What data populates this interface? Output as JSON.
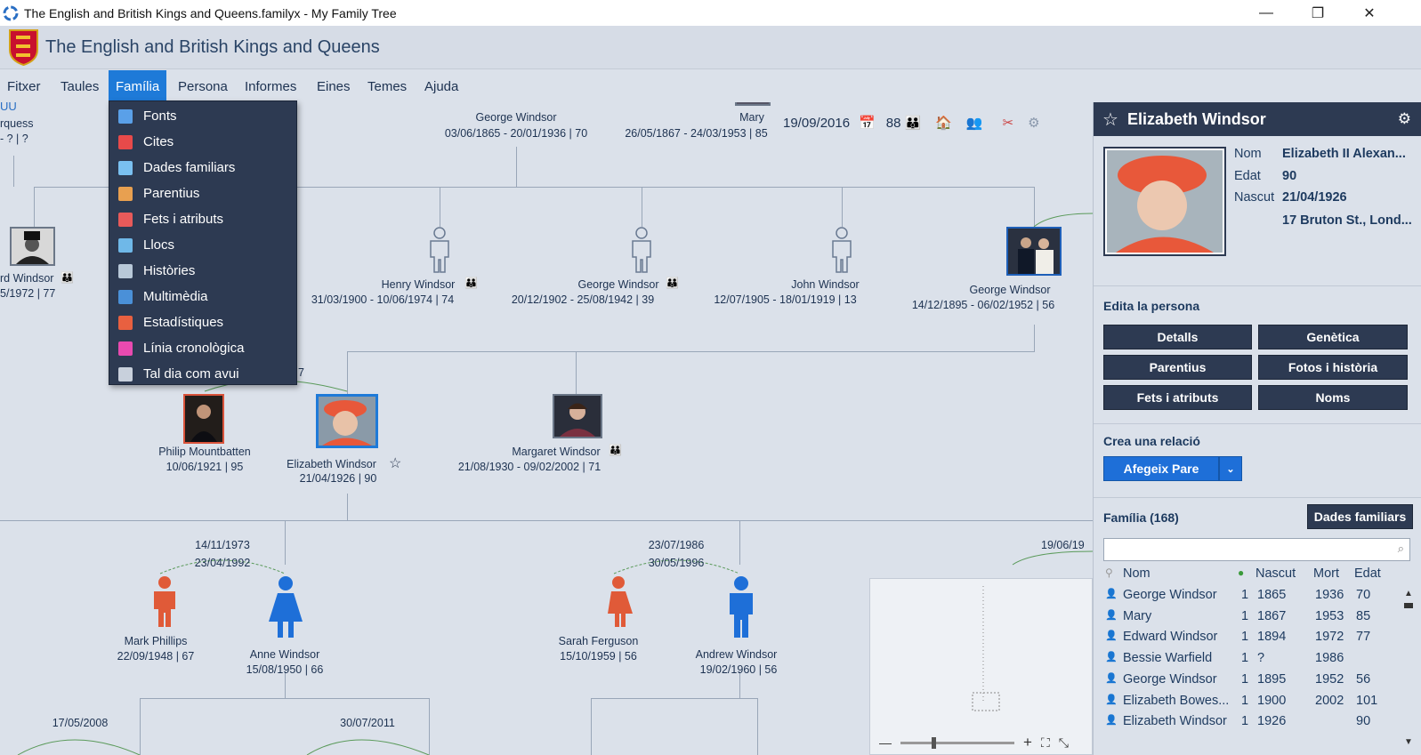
{
  "window": {
    "title": "The English and British Kings and Queens.familyx - My Family Tree",
    "minimize": "—",
    "restore": "❐",
    "close": "✕"
  },
  "header": {
    "app_title": "The English and British Kings and Queens"
  },
  "menu": [
    "Fitxer",
    "Taules",
    "Família",
    "Persona",
    "Informes",
    "Eines",
    "Temes",
    "Ajuda"
  ],
  "dropdown": [
    {
      "label": "Fonts",
      "color": "#5aa0e8"
    },
    {
      "label": "Cites",
      "color": "#e84a4a"
    },
    {
      "label": "Dades familiars",
      "color": "#7ac0f0"
    },
    {
      "label": "Parentius",
      "color": "#e8a050"
    },
    {
      "label": "Fets i atributs",
      "color": "#e85a5a"
    },
    {
      "label": "Llocs",
      "color": "#6fb8e8"
    },
    {
      "label": "Històries",
      "color": "#b8c8d8"
    },
    {
      "label": "Multimèdia",
      "color": "#4a90d8"
    },
    {
      "label": "Estadístiques",
      "color": "#e86040"
    },
    {
      "label": "Línia cronològica",
      "color": "#e84ab0"
    },
    {
      "label": "Tal dia com avui",
      "color": "#c8d0dc"
    }
  ],
  "toolbar": {
    "date": "19/09/2016",
    "count": "88"
  },
  "tree": {
    "top_left_link": "UU",
    "top_left_1": "rquess",
    "top_left_2": "- ? | ?",
    "george_top": {
      "name": "George Windsor",
      "dates": "03/06/1865 - 20/01/1936 | 70"
    },
    "mary_top": {
      "name": "Mary",
      "dates": "26/05/1867 - 24/03/1953 | 85"
    },
    "edward": {
      "name": "rd Windsor",
      "dates": "5/1972 | 77"
    },
    "henry": {
      "name": "Henry Windsor",
      "dates": "31/03/1900 - 10/06/1974 | 74"
    },
    "george_b": {
      "name": "George Windsor",
      "dates": "20/12/1902 - 25/08/1942 | 39"
    },
    "john": {
      "name": "John Windsor",
      "dates": "12/07/1905 - 18/01/1919 | 13"
    },
    "george_vi": {
      "name": "George Windsor",
      "dates": "14/12/1895 - 06/02/1952 | 56"
    },
    "marriage_partial": "7",
    "philip": {
      "name": "Philip Mountbatten",
      "dates": "10/06/1921 | 95"
    },
    "elizabeth": {
      "name": "Elizabeth Windsor",
      "dates": "21/04/1926 | 90"
    },
    "margaret": {
      "name": "Margaret Windsor",
      "dates": "21/08/1930 - 09/02/2002 | 71"
    },
    "m1": "14/11/1973",
    "d1": "23/04/1992",
    "m2": "23/07/1986",
    "d2": "30/05/1996",
    "m3": "19/06/19",
    "mark": {
      "name": "Mark Phillips",
      "dates": "22/09/1948 | 67"
    },
    "anne": {
      "name": "Anne Windsor",
      "dates": "15/08/1950 | 66"
    },
    "sarah": {
      "name": "Sarah Ferguson",
      "dates": "15/10/1959 | 56"
    },
    "andrew": {
      "name": "Andrew Windsor",
      "dates": "19/02/1960 | 56"
    },
    "m4": "17/05/2008",
    "m5": "30/07/2011"
  },
  "panel": {
    "title": "Elizabeth Windsor",
    "fields": [
      {
        "label": "Nom",
        "value": "Elizabeth II Alexan..."
      },
      {
        "label": "Edat",
        "value": "90"
      },
      {
        "label": "Nascut",
        "value": "21/04/1926"
      },
      {
        "label": "",
        "value": "17 Bruton St., Lond..."
      }
    ],
    "edit_title": "Edita la persona",
    "edit_buttons": [
      "Detalls",
      "Genètica",
      "Parentius",
      "Fotos i història",
      "Fets i atributs",
      "Noms"
    ],
    "relation_title": "Crea una relació",
    "add_parent": "Afegeix Pare",
    "family_title": "Família (168)",
    "family_button": "Dades familiars",
    "search_placeholder": "",
    "cols": [
      "Nom",
      "Nascut",
      "Mort",
      "Edat"
    ],
    "rows": [
      {
        "name": "George Windsor",
        "n": "1",
        "born": "1865",
        "died": "1936",
        "age": "70",
        "g": "m"
      },
      {
        "name": "Mary",
        "n": "1",
        "born": "1867",
        "died": "1953",
        "age": "85",
        "g": "f"
      },
      {
        "name": "Edward Windsor",
        "n": "1",
        "born": "1894",
        "died": "1972",
        "age": "77",
        "g": "m"
      },
      {
        "name": "Bessie Warfield",
        "n": "1",
        "born": "?",
        "died": "1986",
        "age": "",
        "g": "f"
      },
      {
        "name": "George Windsor",
        "n": "1",
        "born": "1895",
        "died": "1952",
        "age": "56",
        "g": "m"
      },
      {
        "name": "Elizabeth Bowes...",
        "n": "1",
        "born": "1900",
        "died": "2002",
        "age": "101",
        "g": "f"
      },
      {
        "name": "Elizabeth Windsor",
        "n": "1",
        "born": "1926",
        "died": "",
        "age": "90",
        "g": "f"
      }
    ]
  }
}
